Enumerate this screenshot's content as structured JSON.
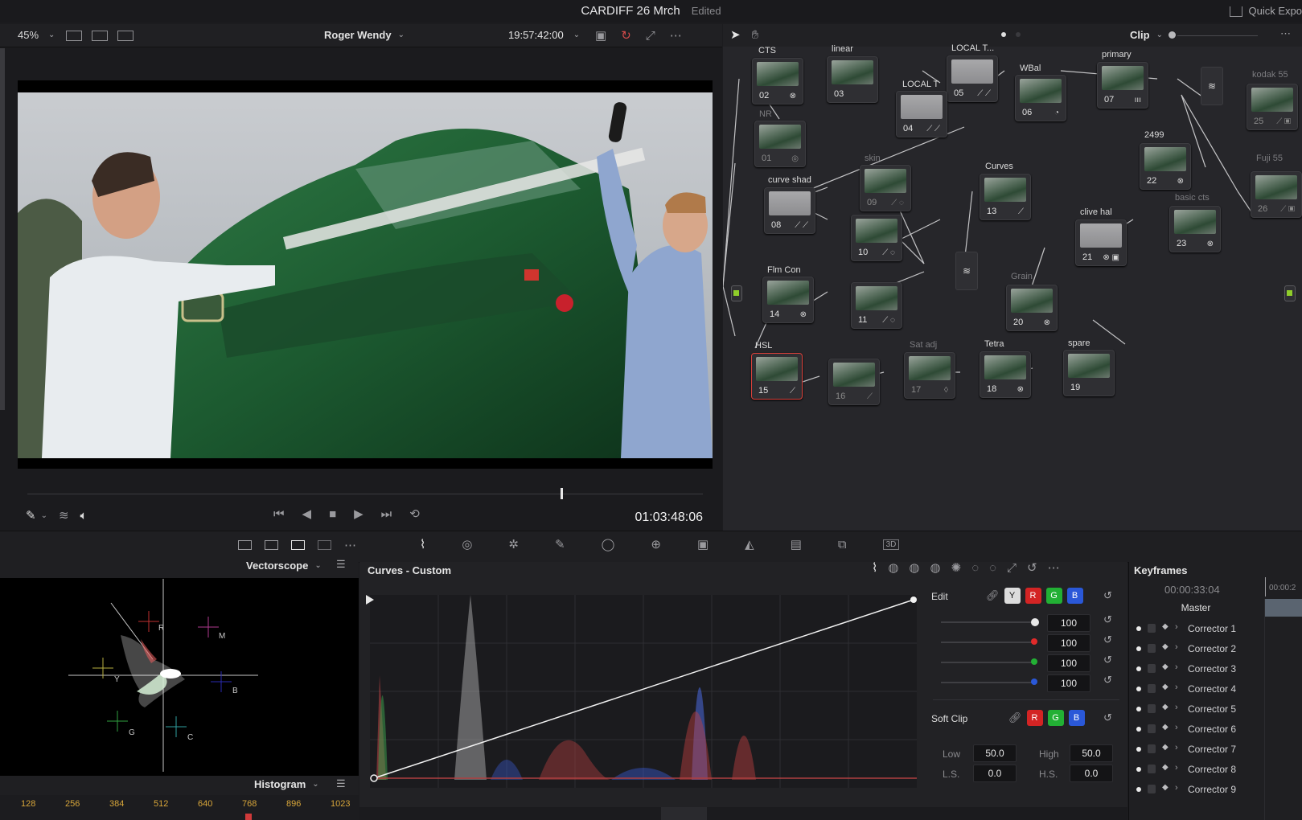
{
  "window": {
    "title": "CARDIFF 26 Mrch",
    "status": "Edited",
    "quick_export": "Quick Expo"
  },
  "viewer": {
    "zoom": "45%",
    "clip_name": "Roger Wendy",
    "source_timecode": "19:57:42:00",
    "timeline_timecode": "01:03:48:06",
    "playhead_position": 0.79
  },
  "nodegraph": {
    "mode_label": "Clip",
    "nodes": [
      {
        "label": "CTS",
        "num": "02",
        "icon": "⊗"
      },
      {
        "label": "linear",
        "num": "03",
        "icon": ""
      },
      {
        "label": "LOCAL T...",
        "num": "05",
        "icon": "⟋ ⟋"
      },
      {
        "label": "LOCAL T",
        "num": "04",
        "icon": "⟋ ⟋"
      },
      {
        "label": "WBal",
        "num": "06",
        "icon": "◔"
      },
      {
        "label": "primary",
        "num": "07",
        "icon": "ııı"
      },
      {
        "label": "kodak 55",
        "num": "25",
        "icon": "⟋ ▣"
      },
      {
        "label": "NR",
        "num": "01",
        "icon": "◎"
      },
      {
        "label": "2499",
        "num": "22",
        "icon": "⊗"
      },
      {
        "label": "Fuji 55",
        "num": "26",
        "icon": "⟋ ▣"
      },
      {
        "label": "skin",
        "num": "09",
        "icon": "⟋ ◌"
      },
      {
        "label": "curve shad",
        "num": "08",
        "icon": "⟋ ⟋"
      },
      {
        "label": "Curves",
        "num": "13",
        "icon": "⟋"
      },
      {
        "label": "basic cts",
        "num": "23",
        "icon": "⊗"
      },
      {
        "label": "",
        "num": "10",
        "icon": "⟋ ◌"
      },
      {
        "label": "clive hal",
        "num": "21",
        "icon": "⊗ ▣"
      },
      {
        "label": "Flm Con",
        "num": "14",
        "icon": "⊗"
      },
      {
        "label": "",
        "num": "11",
        "icon": "⟋ ◌"
      },
      {
        "label": "Grain",
        "num": "20",
        "icon": "⊗"
      },
      {
        "label": "HSL",
        "num": "15",
        "icon": "⟋"
      },
      {
        "label": "",
        "num": "16",
        "icon": "⟋"
      },
      {
        "label": "Sat adj",
        "num": "17",
        "icon": "◊"
      },
      {
        "label": "Tetra",
        "num": "18",
        "icon": "⊗"
      },
      {
        "label": "spare",
        "num": "19",
        "icon": ""
      }
    ]
  },
  "scopes": {
    "vectorscope_label": "Vectorscope",
    "histogram_label": "Histogram",
    "vector_targets": [
      "R",
      "M",
      "Y",
      "B",
      "G",
      "C"
    ],
    "scale": [
      "128",
      "256",
      "384",
      "512",
      "640",
      "768",
      "896",
      "1023"
    ]
  },
  "curves": {
    "title": "Curves - Custom",
    "edit_label": "Edit",
    "channels": [
      "Y",
      "R",
      "G",
      "B"
    ],
    "intensity_values": [
      "100",
      "100",
      "100",
      "100"
    ],
    "soft_clip_label": "Soft Clip",
    "low_label": "Low",
    "low_value": "50.0",
    "high_label": "High",
    "high_value": "50.0",
    "ls_label": "L.S.",
    "ls_value": "0.0",
    "hs_label": "H.S.",
    "hs_value": "0.0"
  },
  "keyframes": {
    "title": "Keyframes",
    "timecode": "00:00:33:04",
    "timecode_right": "00:00:2",
    "master_label": "Master",
    "rows": [
      "Corrector 1",
      "Corrector 2",
      "Corrector 3",
      "Corrector 4",
      "Corrector 5",
      "Corrector 6",
      "Corrector 7",
      "Corrector 8",
      "Corrector 9"
    ]
  },
  "colors": {
    "accent_red": "#d8403a",
    "pin_green": "#8fcd2a",
    "pin_blue": "#2a9bd8"
  }
}
